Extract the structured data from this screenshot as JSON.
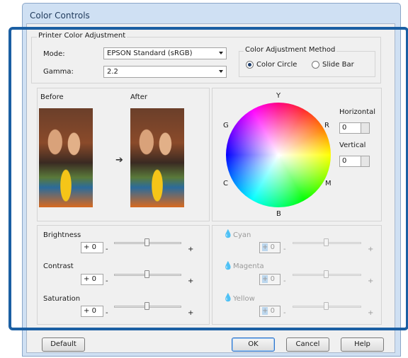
{
  "window": {
    "title": "Color Controls"
  },
  "printer_adjust": {
    "title": "Printer Color Adjustment",
    "mode_label": "Mode:",
    "mode_value": "EPSON Standard (sRGB)",
    "gamma_label": "Gamma:",
    "gamma_value": "2.2"
  },
  "method": {
    "title": "Color Adjustment Method",
    "options": [
      "Color Circle",
      "Slide Bar"
    ],
    "selected": "Color Circle"
  },
  "preview": {
    "before_label": "Before",
    "after_label": "After"
  },
  "circle": {
    "labels": {
      "y": "Y",
      "r": "R",
      "m": "M",
      "b": "B",
      "c": "C",
      "g": "G"
    },
    "horizontal_label": "Horizontal",
    "horizontal_value": "0",
    "vertical_label": "Vertical",
    "vertical_value": "0"
  },
  "sliders": [
    {
      "label": "Brightness",
      "sign": "+",
      "value": "0",
      "minus": "-",
      "plus": "+"
    },
    {
      "label": "Contrast",
      "sign": "+",
      "value": "0",
      "minus": "-",
      "plus": "+"
    },
    {
      "label": "Saturation",
      "sign": "+",
      "value": "0",
      "minus": "-",
      "plus": "+"
    }
  ],
  "color_sliders": [
    {
      "label": "Cyan",
      "sign": "+",
      "value": "0",
      "minus": "-",
      "plus": "+",
      "icon": "cyan-drop-icon",
      "color": "#1aa7e8"
    },
    {
      "label": "Magenta",
      "sign": "+",
      "value": "0",
      "minus": "-",
      "plus": "+",
      "icon": "magenta-drop-icon",
      "color": "#c42ab8"
    },
    {
      "label": "Yellow",
      "sign": "+",
      "value": "0",
      "minus": "-",
      "plus": "+",
      "icon": "yellow-drop-icon",
      "color": "#f0c400"
    }
  ],
  "buttons": {
    "default": "Default",
    "ok": "OK",
    "cancel": "Cancel",
    "help": "Help"
  },
  "colors": {
    "highlight": "#1b5fa3",
    "dialog_bg": "#f0f0f0"
  }
}
